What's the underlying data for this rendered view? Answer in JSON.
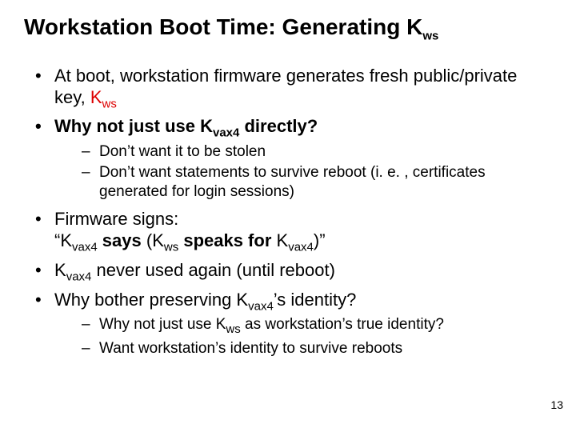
{
  "title": {
    "pre": "Workstation Boot Time: Generating K",
    "sub": "ws"
  },
  "b1": {
    "pre": "At boot, workstation firmware generates fresh public/private key, ",
    "k": "K",
    "sub": "ws"
  },
  "b2": {
    "pre": "Why not just use K",
    "sub": "vax4",
    "post": " directly?"
  },
  "b2s1": "Don’t want it to be stolen",
  "b2s2": "Don’t want statements to survive reboot (i. e. , certificates generated for login sessions)",
  "b3": {
    "pre": "Firmware signs:",
    "q1": "“K",
    "sub1": "vax4",
    "says": " says",
    "open": " (K",
    "sub2": "ws",
    "speaks": " speaks for",
    "k2": " K",
    "sub3": "vax4",
    "close": ")”"
  },
  "b4": {
    "k": "K",
    "sub": "vax4",
    "post": " never used again (until reboot)"
  },
  "b5": {
    "pre": "Why bother preserving K",
    "sub": "vax4",
    "post": "’s identity?"
  },
  "b5s1": {
    "pre": "Why not just use K",
    "sub": "ws",
    "post": " as workstation’s true identity?"
  },
  "b5s2": "Want workstation’s identity to survive reboots",
  "page": "13"
}
